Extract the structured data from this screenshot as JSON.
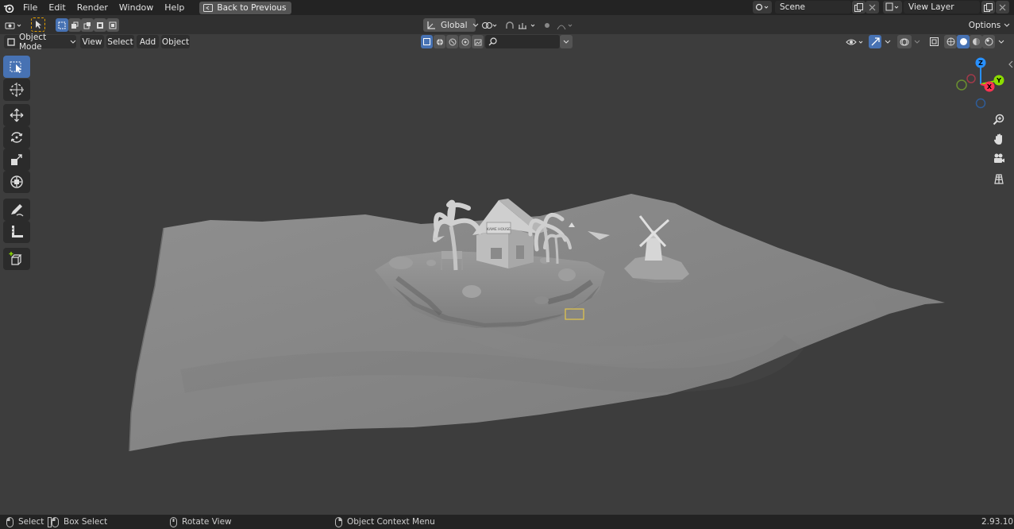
{
  "topbar": {
    "menus": [
      "File",
      "Edit",
      "Render",
      "Window",
      "Help"
    ],
    "back_button": "Back to Previous",
    "scene": "Scene",
    "view_layer": "View Layer"
  },
  "header": {
    "transform_orientation": "Global",
    "options_label": "Options",
    "mode": "Object Mode",
    "menus": [
      "View",
      "Select",
      "Add",
      "Object"
    ],
    "search_placeholder": ""
  },
  "toolbar": {
    "tools": [
      "select-box",
      "cursor",
      "move",
      "rotate",
      "scale",
      "transform",
      "annotate",
      "measure",
      "add-cube"
    ],
    "active_tool": "select-box"
  },
  "gizmo": {
    "axes": {
      "z": "Z",
      "y": "Y",
      "x": "X"
    },
    "colors": {
      "x": "#ff3352",
      "y": "#8bdc00",
      "z": "#2890ff"
    }
  },
  "scene_text": {
    "house_sign": "KAME HOUSE"
  },
  "statusbar": {
    "select": "Select",
    "box_select": "Box Select",
    "rotate_view": "Rotate View",
    "context_menu": "Object Context Menu",
    "version": "2.93.10"
  },
  "colors": {
    "accent": "#4772b3",
    "selection_outline": "#e5c64a",
    "background": "#3d3d3d"
  }
}
